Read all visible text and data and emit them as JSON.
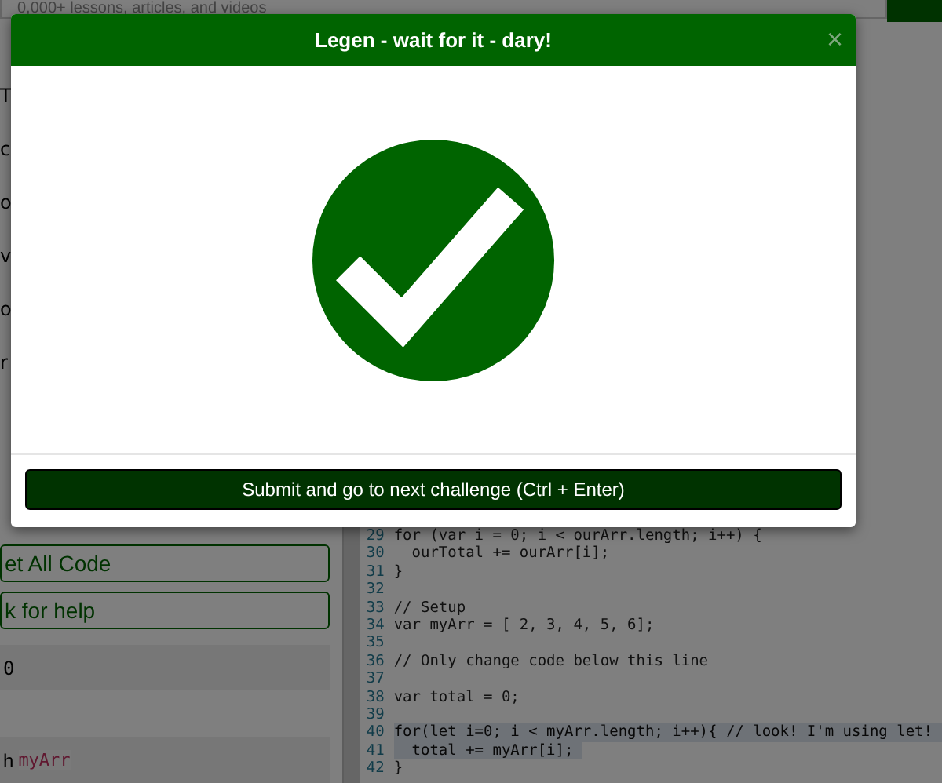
{
  "search": {
    "placeholder": "0,000+ lessons, articles, and videos"
  },
  "left_panel": {
    "fragments": [
      "T",
      "c",
      "o",
      "v",
      "o",
      "r"
    ],
    "buttons": [
      "et All Code",
      "k for help"
    ],
    "output": "0",
    "hint": {
      "text": "h",
      "code": "myArr"
    }
  },
  "editor": {
    "lines": [
      {
        "number": "29",
        "code": "for (var i = 0; i < ourArr.length; i++) {",
        "selected": false
      },
      {
        "number": "30",
        "code": "  ourTotal += ourArr[i];",
        "selected": false
      },
      {
        "number": "31",
        "code": "}",
        "selected": false
      },
      {
        "number": "32",
        "selected": false
      },
      {
        "number": "33",
        "code": "// Setup",
        "selected": false
      },
      {
        "number": "34",
        "code": "var myArr = [ 2, 3, 4, 5, 6];",
        "selected": false
      },
      {
        "number": "35",
        "selected": false
      },
      {
        "number": "36",
        "code": "// Only change code below this line",
        "selected": false
      },
      {
        "number": "37",
        "selected": false
      },
      {
        "number": "38",
        "code": "var total = 0;",
        "selected": false
      },
      {
        "number": "39",
        "selected": false
      },
      {
        "number": "40",
        "code": "for(let i=0; i < myArr.length; i++){ // look! I'm using let!",
        "selected": true
      },
      {
        "number": "41",
        "code": "  total += myArr[i];",
        "selected": true
      },
      {
        "number": "42",
        "code": "}",
        "selected": false
      }
    ]
  },
  "modal": {
    "title": "Legen - wait for it - dary!",
    "close": "×",
    "submit_button": "Submit and go to next challenge (Ctrl + Enter)"
  }
}
